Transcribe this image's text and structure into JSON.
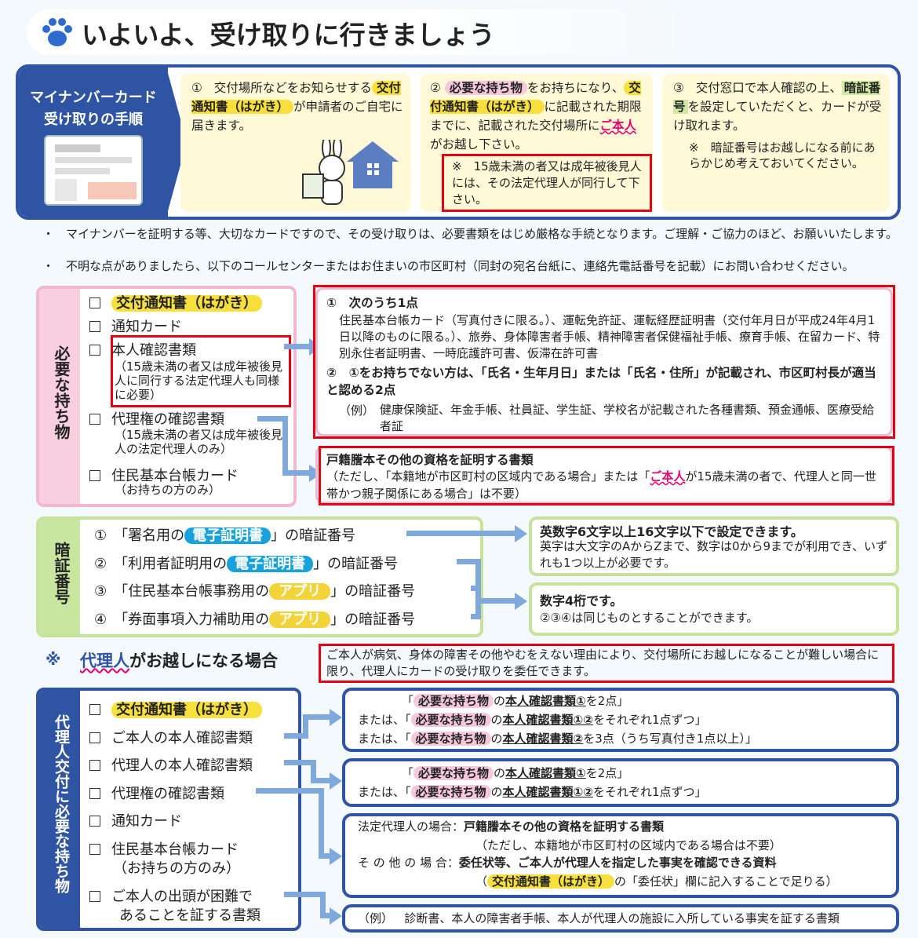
{
  "title": "いよいよ、受け取りに行きましょう",
  "steps": {
    "label_line1": "マイナンバーカード",
    "label_line2": "受け取りの手順",
    "step1_num": "①",
    "step1_pre": "交付場所などをお知らせする",
    "step1_hl": "交付通知書（はがき）",
    "step1_post": "が申請者のご自宅に届きます。",
    "step2_num": "②",
    "step2_hl1": "必要な持ち物",
    "step2_t1": "をお持ちになり、",
    "step2_hl2": "交付通知書（はがき）",
    "step2_t2": "に記載された期限までに、記載された交付場所に",
    "step2_red": "ご本人",
    "step2_t3": "がお越し下さい。",
    "step2_note": "※　15歳未満の者又は成年被後見人には、その法定代理人が同行して下さい。",
    "step3_num": "③",
    "step3_t1": "交付窓口で本人確認の上、",
    "step3_hl": "暗証番号",
    "step3_t2": "を設定していただくと、カードが受け取れます。",
    "step3_note": "※　暗証番号はお越しになる前にあらかじめ考えておいてください。"
  },
  "notes": [
    "・　マイナンバーを証明する等、大切なカードですので、その受け取りは、必要書類をはじめ厳格な手続となります。ご理解・ご協力のほど、お願いいたします。",
    "・　不明な点がありましたら、以下のコールセンターまたはお住まいの市区町村（同封の宛名台紙に、連絡先電話番号を記載）にお問い合わせください。"
  ],
  "required": {
    "side_label": "必要な持ち物",
    "item1": "交付通知書（はがき）",
    "item2": "通知カード",
    "item3": "本人確認書類",
    "item3_sub": "（15歳未満の者又は成年被後見人に同行する法定代理人も同様に必要）",
    "item4": "代理権の確認書類",
    "item4_sub": "（15歳未満の者又は成年被後見人の法定代理人のみ）",
    "item5": "住民基本台帳カード",
    "item5_sub": "（お持ちの方のみ）",
    "id_h1": "①　次のうち1点",
    "id_t1": "住民基本台帳カード（写真付きに限る。）、運転免許証、運転経歴証明書（交付年月日が平成24年4月1日以降のものに限る。）、旅券、身体障害者手帳、精神障害者保健福祉手帳、療育手帳、在留カード、特別永住者証明書、一時庇護許可書、仮滞在許可書",
    "id_h2": "②　①をお持ちでない方は、「氏名・生年月日」または「氏名・住所」が記載され、市区町村長が適当と認める2点",
    "id_ex_label": "（例）",
    "id_ex": "健康保険証、年金手帳、社員証、学生証、学校名が記載された各種書類、預金通帳、医療受給者証",
    "koseki_h": "戸籍謄本その他の資格を証明する書類",
    "koseki_t1": "（ただし、「本籍地が市区町村の区域内である場合」または「",
    "koseki_red": "ご本人",
    "koseki_t2": "が15歳未満の者で、代理人と同一世帯かつ親子関係にある場合」は不要）"
  },
  "pin": {
    "side_label": "暗証番号",
    "r1_a": "①　「署名用の",
    "r1_pill": "電子証明書",
    "r1_b": "」の暗証番号",
    "r2_a": "②　「利用者証明用の",
    "r2_pill": "電子証明書",
    "r2_b": "」の暗証番号",
    "r3_a": "③　「住民基本台帳事務用の",
    "r3_pill": "アプリ",
    "r3_b": "」の暗証番号",
    "r4_a": "④　「券面事項入力補助用の",
    "r4_pill": "アプリ",
    "r4_b": "」の暗証番号",
    "box1_h": "英数字6文字以上16文字以下で設定できます。",
    "box1_t": "英字は大文字のAからZまで、数字は0から9までが利用でき、いずれも1つ以上が必要です。",
    "box2_h": "数字4桁です。",
    "box2_t": "②③④は同じものとすることができます。"
  },
  "proxy": {
    "mark": "※",
    "title_red": "代理人",
    "title_rest": "がお越しになる場合",
    "desc": "ご本人が病気、身体の障害その他やむをえない理由により、交付場所にお越しになることが難しい場合に限り、代理人にカードの受け取りを委任できます。",
    "side_label": "代理人交付に必要な持ち物",
    "item1": "交付通知書（はがき）",
    "item2": "ご本人の本人確認書類",
    "item3": "代理人の本人確認書類",
    "item4": "代理権の確認書類",
    "item5": "通知カード",
    "item6_l1": "住民基本台帳カード",
    "item6_l2": "（お持ちの方のみ）",
    "item7_l1": "ご本人の出頭が困難で",
    "item7_l2": "あることを証する書類",
    "hl_motimono": "必要な持ち物",
    "no": "の",
    "id_doc1": "本人確認書類①",
    "id_doc12": "本人確認書類①②",
    "id_doc2": "本人確認書類②",
    "q_open": "「",
    "or_open": "または、「",
    "a_t1": "を2点」",
    "a_t2": "をそれぞれ1点ずつ」",
    "a_t3": "を3点（うち写真付き1点以上）」",
    "c_l1_label": "法定代理人の場合：",
    "c_l1": "戸籍謄本その他の資格を証明する書類",
    "c_l2": "（ただし、本籍地が市区町村の区域内である場合は不要）",
    "c_l3_label": "そ の 他 の 場 合：",
    "c_l3": "委任状等、ご本人が代理人を指定した事実を確認できる資料",
    "c_l4_open": "（",
    "c_l4_hl": "交付通知書（はがき）",
    "c_l4": "の「委任状」欄に記入することで足りる）",
    "d_label": "（例）",
    "d_text": "診断書、本人の障害者手帳、本人が代理人の施設に入所している事実を証する書類"
  },
  "colors": {
    "navy": "#2f54a4",
    "pink": "#f2b8cf",
    "green": "#9ccf55",
    "yellow_bg": "#fff9d7",
    "red_frame": "#e60012",
    "accent_red": "#e5006e",
    "blue_pill": "#17a2dc"
  }
}
